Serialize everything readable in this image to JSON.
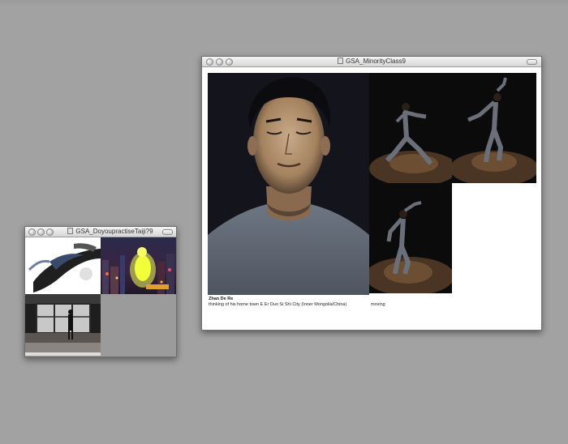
{
  "window_left": {
    "title": "GSA_DoyoupractiseTaiji?9"
  },
  "window_right": {
    "title": "GSA_MinorityClass9",
    "caption_name": "Zhan De Re",
    "caption_desc": "thinking of his home town E Er Duo Si Shi City (Inner Mongolia/China)",
    "caption_moving": "moving"
  }
}
